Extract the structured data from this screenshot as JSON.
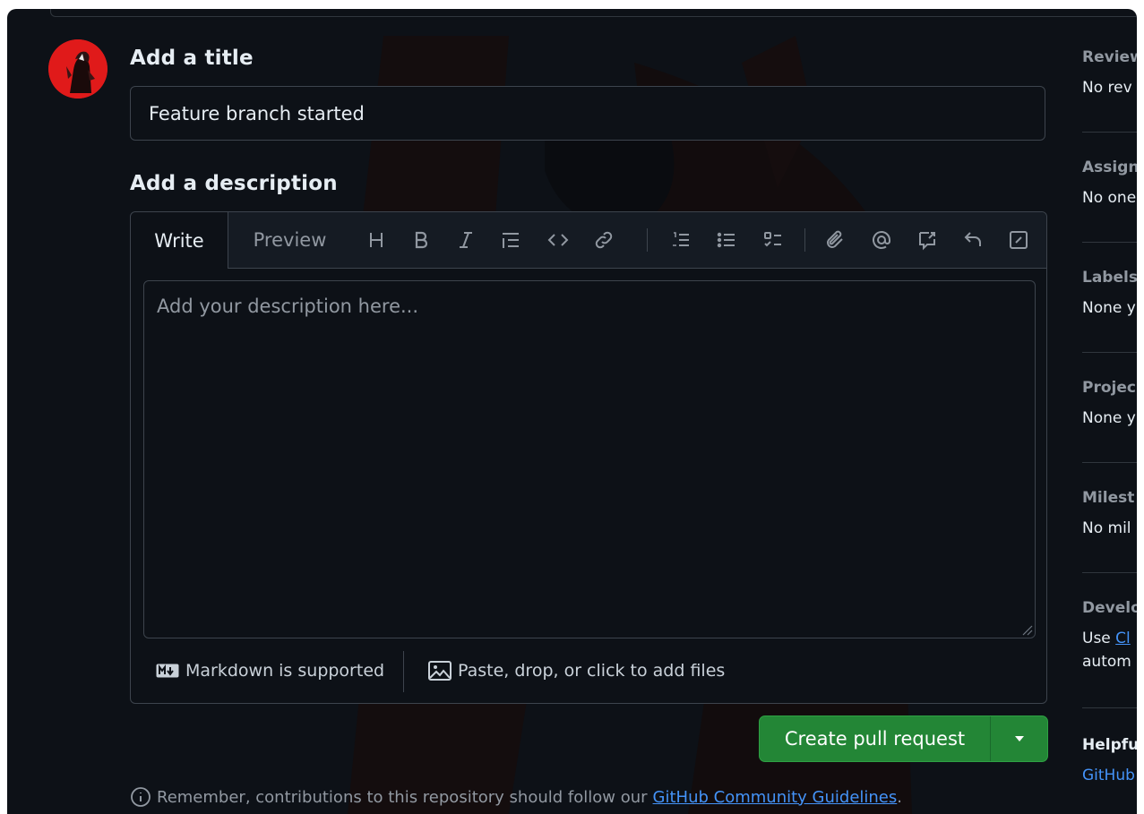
{
  "form": {
    "title_heading": "Add a title",
    "title_value": "Feature branch started",
    "description_heading": "Add a description"
  },
  "editor": {
    "tabs": {
      "write": "Write",
      "preview": "Preview"
    },
    "placeholder": "Add your description here...",
    "markdown_note": "Markdown is supported",
    "files_note": "Paste, drop, or click to add files",
    "toolbar_icons": [
      "heading-icon",
      "bold-icon",
      "italic-icon",
      "quote-icon",
      "code-icon",
      "link-icon",
      "ordered-list-icon",
      "unordered-list-icon",
      "task-list-icon",
      "attach-icon",
      "mention-icon",
      "reference-icon",
      "undo-icon",
      "slash-command-icon"
    ]
  },
  "actions": {
    "create_label": "Create pull request"
  },
  "reminder": {
    "text": "Remember, contributions to this repository should follow our",
    "link": "GitHub Community Guidelines",
    "end": "."
  },
  "sidebar": {
    "reviewers": {
      "title": "Review",
      "value": "No rev"
    },
    "assignees": {
      "title": "Assign",
      "value": "No one"
    },
    "labels": {
      "title": "Labels",
      "value": "None y"
    },
    "projects": {
      "title": "Projec",
      "value": "None y"
    },
    "milestone": {
      "title": "Milest",
      "value": "No mil"
    },
    "development": {
      "title": "Develo",
      "value_prefix": "Use ",
      "link": "Cl",
      "value_line2": "autom"
    },
    "helpful": {
      "title": "Helpfu",
      "link": "GitHub"
    }
  },
  "colors": {
    "background": "#0d1117",
    "primary_button": "#238636",
    "link": "#4493f8",
    "border": "#3d444d"
  }
}
